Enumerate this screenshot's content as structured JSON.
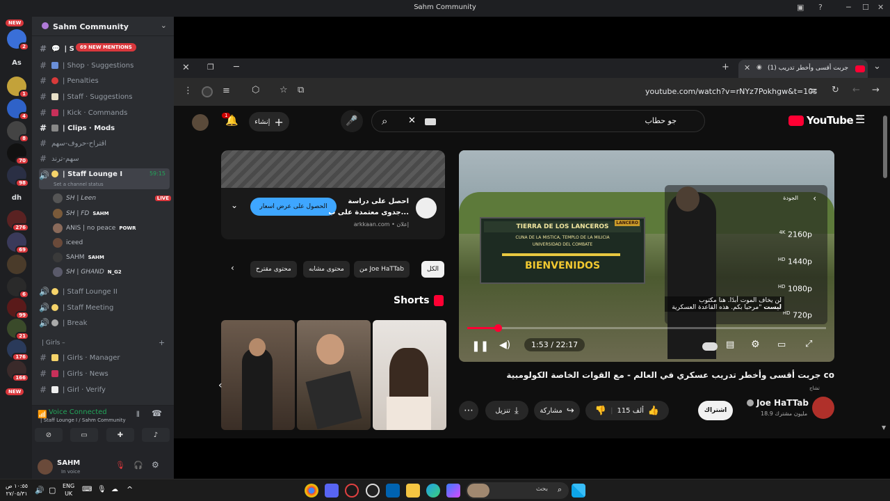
{
  "window": {
    "title": "Sahm Community"
  },
  "discord": {
    "server_name": "Sahm Community",
    "mentions_badge": "69 NEW MENTIONS",
    "rail_new_top": "NEW",
    "rail_new_bottom": "NEW",
    "rail_labels": [
      "As",
      "dh"
    ],
    "rail_badges": [
      "2",
      "1",
      "4",
      "6",
      "8",
      "70",
      "98",
      "276",
      "69",
      "6",
      "99",
      "21",
      "176",
      "166"
    ],
    "channels": [
      {
        "label": "| Shop · Suggestions",
        "icon": "shop-icon"
      },
      {
        "label": "| Penalties",
        "icon": "no-entry-icon"
      },
      {
        "label": "| Staff · Suggestions",
        "icon": "memo-icon"
      },
      {
        "label": "| Kick · Commands",
        "icon": "square-icon"
      },
      {
        "label": "| Clips · Mods",
        "icon": "film-icon"
      },
      {
        "label": "اقتراح-حروف-سهم",
        "icon": "hash-icon"
      },
      {
        "label": "سهم-ترند",
        "icon": "hash-icon"
      }
    ],
    "voice_channel": {
      "label": "| Staff Lounge I",
      "time": "59:15",
      "status": "Set a channel status"
    },
    "voice_users": [
      {
        "name": "SH | Leen",
        "tag": "LIVE"
      },
      {
        "name": "SH | FD",
        "tag": "SAHM"
      },
      {
        "name": "ANIS | no peace",
        "tag": "POWR"
      },
      {
        "name": "iceed",
        "tag": ""
      },
      {
        "name": "SAHM",
        "tag": "SAHM"
      },
      {
        "name": "SH | GHAND",
        "tag": "N_G2"
      }
    ],
    "more_channels": [
      {
        "label": "| Staff Lounge II"
      },
      {
        "label": "| Staff Meeting"
      },
      {
        "label": "| Break"
      }
    ],
    "category": "| Girls –",
    "girls_channels": [
      {
        "label": "| Girls · Manager"
      },
      {
        "label": "| Girls · News"
      },
      {
        "label": "| Girl · Verify"
      }
    ],
    "voice_connected": "Voice Connected",
    "voice_location": "| Staff Lounge I / Sahm Community",
    "user": {
      "name": "SAHM",
      "status": "In voice"
    }
  },
  "browser": {
    "tab_title": "(1) جربت أقسى وأخطر تدريب",
    "url": "youtube.com/watch?v=rNYz7Pokhgw&t=10s"
  },
  "youtube": {
    "logo": "YouTube",
    "region": "SA",
    "search_value": "جو حطاب",
    "create_label": "إنشاء",
    "notif_count": "1",
    "video": {
      "title": "جربت أقسى وأخطر تدريب عسكري في العالم - مع القوات الخاصة الكولومبية co",
      "time": "1:53 / 22:17",
      "progress": 0.085,
      "caption_line1": "لن يخاف الموت أبدًا.  هنا مكتوب",
      "caption_line2": "\"مرحبا بكم. هذه القاعدة العسكرية",
      "caption_word": "ليست",
      "sign_line1": "TIERRA DE LOS LANCEROS",
      "sign_line2": "CUNA DE LA MISTICA, TEMPLO DE LA MILICIA",
      "sign_line3": "UNIVERSIDAD DEL COMBATE",
      "sign_line4": "BIENVENIDOS",
      "sign_badge": "LANCERO",
      "quality_header": "الجودة",
      "qualities": [
        {
          "tag": "4K",
          "value": "2160p"
        },
        {
          "tag": "HD",
          "value": "1440p"
        },
        {
          "tag": "HD",
          "value": "1080p"
        },
        {
          "tag": "HD",
          "value": "720p"
        }
      ]
    },
    "channel": {
      "name": "Joe HaTTab",
      "subs": "18.9 مليون مشترك",
      "subscribe": "اشتراك",
      "sub_label": "تشاج"
    },
    "actions": {
      "likes": "115 ألف",
      "share": "مشاركة",
      "download": "تنزيل"
    },
    "ad": {
      "title_line1": "احصل على دراسة",
      "title_line2": "جدوى معتمدة على ب...",
      "domain": "arkkaan.com • إعلان",
      "cta": "الحصول على عرض اسعار"
    },
    "chips": [
      "الكل",
      "من Joe HaTTab",
      "محتوى مشابه",
      "محتوى مقترح"
    ],
    "shorts_label": "Shorts"
  },
  "taskbar": {
    "clock_time": "١٠:٥٥ ص",
    "clock_date": "٢٧/٠٥/٣١",
    "lang": "ENG",
    "lang2": "UK",
    "search_placeholder": "بحث"
  }
}
